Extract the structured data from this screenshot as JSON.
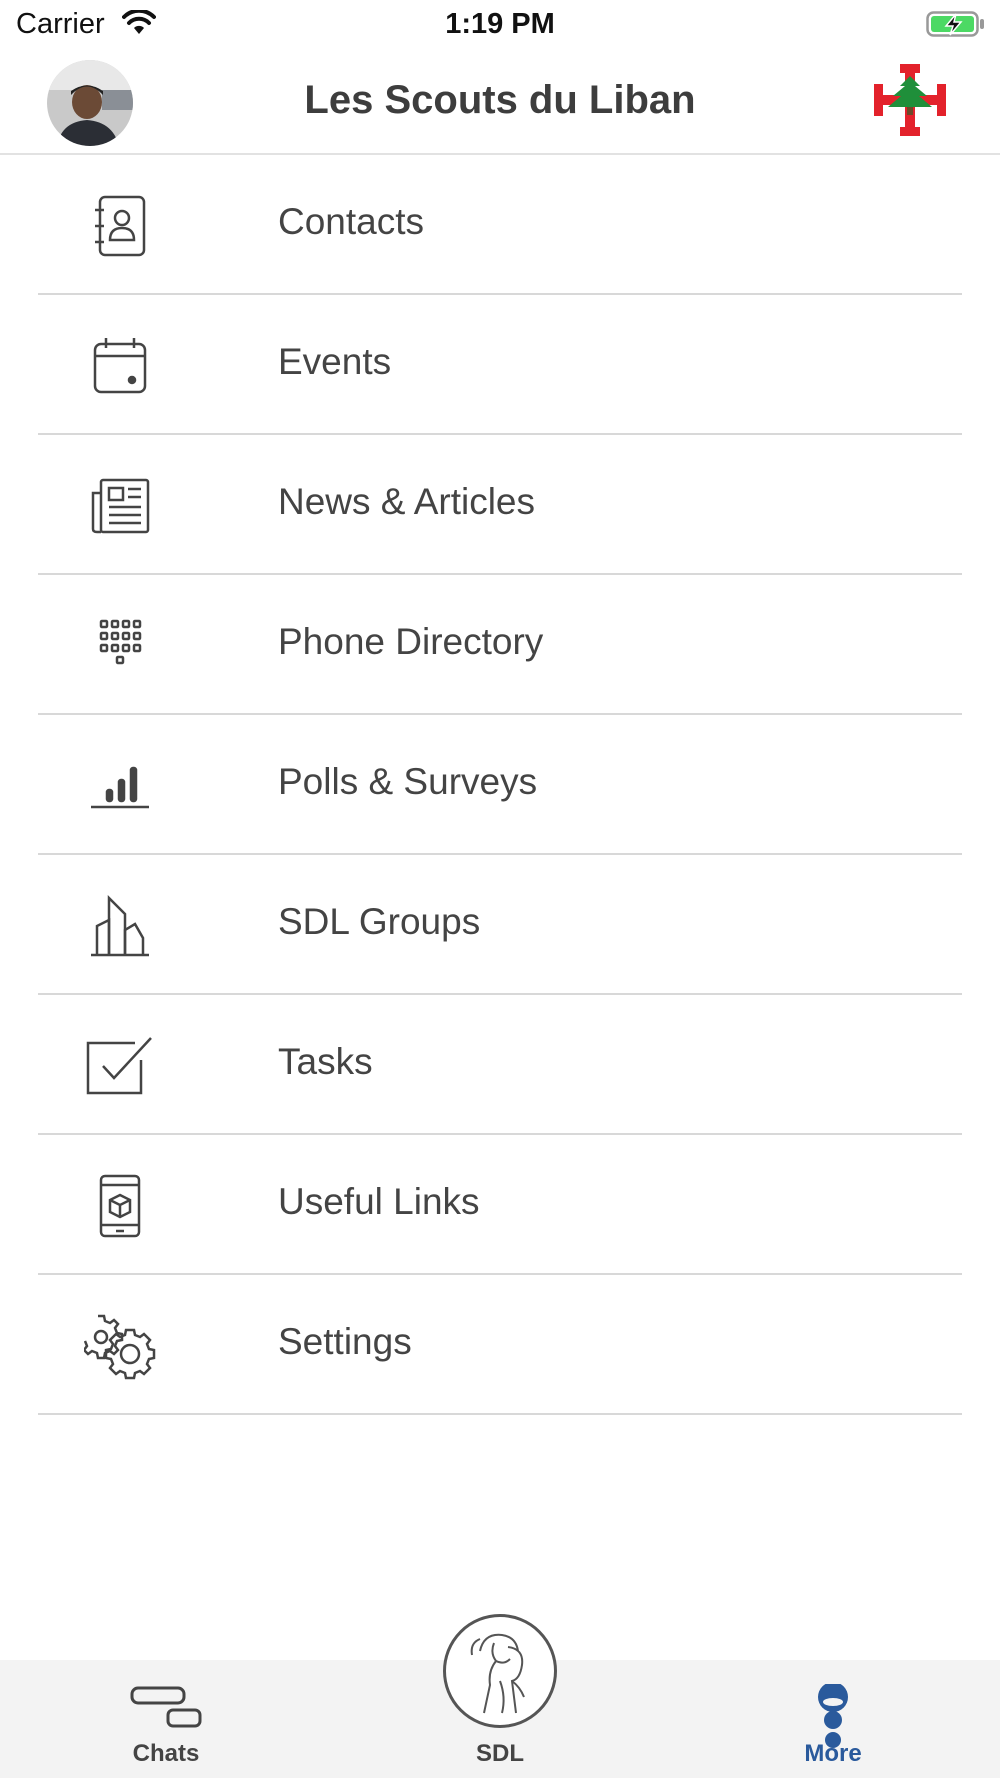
{
  "status_bar": {
    "carrier": "Carrier",
    "time": "1:19 PM",
    "wifi_icon": "wifi-icon",
    "battery_icon": "battery-charging-icon"
  },
  "header": {
    "title": "Les Scouts du Liban",
    "avatar": "user-avatar",
    "logo": "scouts-du-liban-logo"
  },
  "menu": {
    "items": [
      {
        "label": "Contacts",
        "icon": "contacts-book-icon"
      },
      {
        "label": "Events",
        "icon": "calendar-icon"
      },
      {
        "label": "News & Articles",
        "icon": "newspaper-icon"
      },
      {
        "label": "Phone Directory",
        "icon": "keypad-icon"
      },
      {
        "label": "Polls & Surveys",
        "icon": "bar-chart-icon"
      },
      {
        "label": "SDL Groups",
        "icon": "buildings-icon"
      },
      {
        "label": "Tasks",
        "icon": "checkbox-icon"
      },
      {
        "label": "Useful Links",
        "icon": "mobile-box-icon"
      },
      {
        "label": "Settings",
        "icon": "gears-icon"
      }
    ]
  },
  "tab_bar": {
    "tabs": [
      {
        "label": "Chats",
        "icon": "chats-icon",
        "active": false
      },
      {
        "label": "SDL",
        "icon": "scout-emblem-icon",
        "active": false
      },
      {
        "label": "More",
        "icon": "more-dots-icon",
        "active": true
      }
    ],
    "active_color": "#2a5a9c"
  }
}
